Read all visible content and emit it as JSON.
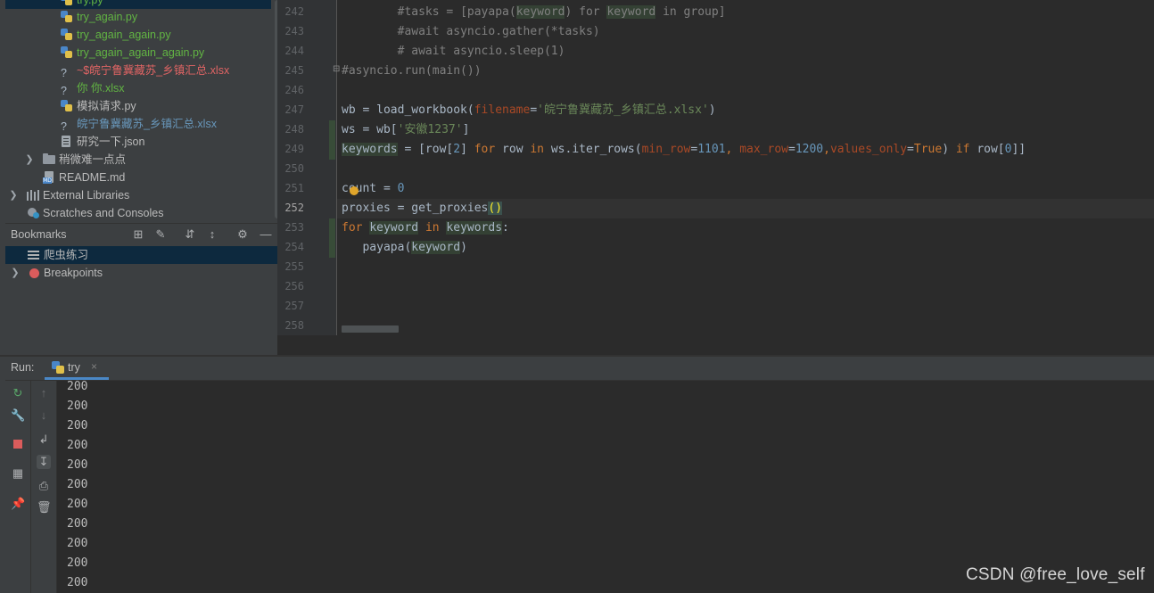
{
  "project_tree": {
    "items": [
      {
        "label": "try.py",
        "kind": "py",
        "color": "#62b543"
      },
      {
        "label": "try_again.py",
        "kind": "py",
        "color": "#62b543"
      },
      {
        "label": "try_again_again.py",
        "kind": "py",
        "color": "#62b543"
      },
      {
        "label": "try_again_again_again.py",
        "kind": "py",
        "color": "#62b543"
      },
      {
        "label": "~$皖宁鲁冀藏苏_乡镇汇总.xlsx",
        "kind": "xlsx",
        "color": "#e06464"
      },
      {
        "label": "你        你.xlsx",
        "kind": "xlsx",
        "color": "#62b543"
      },
      {
        "label": "模拟请求.py",
        "kind": "py",
        "color": "#bbbbbb"
      },
      {
        "label": "皖宁鲁冀藏苏_乡镇汇总.xlsx",
        "kind": "xlsx",
        "color": "#6897bb"
      },
      {
        "label": "研究一下.json",
        "kind": "json",
        "color": "#bbbbbb"
      },
      {
        "label": "稍微难一点点",
        "kind": "folder",
        "color": "#bbbbbb"
      },
      {
        "label": "README.md",
        "kind": "md",
        "color": "#bbbbbb"
      },
      {
        "label": "External Libraries",
        "kind": "lib",
        "color": "#bbbbbb"
      },
      {
        "label": "Scratches and Consoles",
        "kind": "scratch",
        "color": "#bbbbbb"
      }
    ]
  },
  "bookmarks": {
    "title": "Bookmarks",
    "items": [
      {
        "label": "爬虫练习"
      },
      {
        "label": "Breakpoints"
      }
    ]
  },
  "editor": {
    "line_numbers": [
      "242",
      "243",
      "244",
      "245",
      "246",
      "247",
      "248",
      "249",
      "250",
      "251",
      "252",
      "253",
      "254",
      "255",
      "256",
      "257",
      "258"
    ],
    "current_line": "252",
    "code": {
      "l242a": "#tasks = [payapa(",
      "l242b": "keyword",
      "l242c": ") for ",
      "l242d": "keyword",
      "l242e": " in group]",
      "l243": "#await asyncio.gather(*tasks)",
      "l244": "# await asyncio.sleep(1)",
      "l245": "#asyncio.run(main())",
      "l247a": "wb = load_workbook(",
      "l247b": "filename",
      "l247c": "=",
      "l247d": "'皖宁鲁冀藏苏_乡镇汇总.xlsx'",
      "l247e": ")",
      "l248a": "ws = wb[",
      "l248b": "'安徽1237'",
      "l248c": "]",
      "l249a": "keywords",
      "l249b": " = [row[",
      "l249c": "2",
      "l249d": "] ",
      "l249e": "for",
      "l249f": " row ",
      "l249g": "in",
      "l249h": " ws.iter_rows(",
      "l249i": "min_row",
      "l249j": "=",
      "l249k": "1101",
      "l249l": ", ",
      "l249m": "max_row",
      "l249n": "=",
      "l249o": "1200",
      "l249p": ",",
      "l249q": "values_only",
      "l249r": "=",
      "l249s": "True",
      "l249t": ") ",
      "l249u": "if",
      "l249v": " row[",
      "l249w": "0",
      "l249x": "]]",
      "l251a": "count = ",
      "l251b": "0",
      "l252a": "proxies = get_proxies",
      "l252b": "()",
      "l253a": "for ",
      "l253b": "keyword",
      "l253c": " ",
      "l253d": "in",
      "l253e": " ",
      "l253f": "keywords",
      "l253g": ":",
      "l254a": "payapa(",
      "l254b": "keyword",
      "l254c": ")"
    }
  },
  "run": {
    "label": "Run:",
    "tab": "try",
    "close": "×",
    "output": [
      "200",
      "200",
      "200",
      "200",
      "200",
      "200",
      "200",
      "200",
      "200",
      "200",
      "200"
    ]
  },
  "watermark": "CSDN @free_love_self"
}
